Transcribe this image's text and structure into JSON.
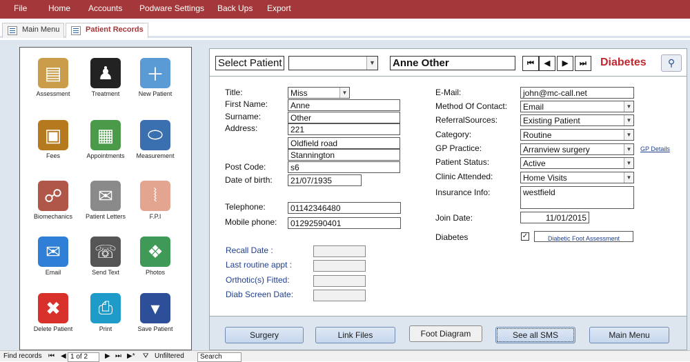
{
  "ribbon": {
    "menus": [
      "File",
      "Home",
      "Accounts",
      "Podware Settings",
      "Back Ups",
      "Export"
    ]
  },
  "tabs": [
    {
      "label": "Main Menu",
      "active": false
    },
    {
      "label": "Patient Records",
      "active": true
    }
  ],
  "tiles": [
    {
      "label": "Assessment",
      "icon": "assessment-icon",
      "color": "#c99d4a",
      "glyph": "▤"
    },
    {
      "label": "Treatment",
      "icon": "treatment-icon",
      "color": "#222222",
      "glyph": "♟"
    },
    {
      "label": "New Patient",
      "icon": "new-patient-icon",
      "color": "#5b9bd5",
      "glyph": "＋"
    },
    {
      "label": "Fees",
      "icon": "fees-icon",
      "color": "#b57a1e",
      "glyph": "▣"
    },
    {
      "label": "Appointments",
      "icon": "appointments-icon",
      "color": "#4a9a4a",
      "glyph": "▦"
    },
    {
      "label": "Measurement",
      "icon": "measurement-icon",
      "color": "#3a6fb0",
      "glyph": "⬭"
    },
    {
      "label": "Biomechanics",
      "icon": "biomechanics-icon",
      "color": "#b0574a",
      "glyph": "☍"
    },
    {
      "label": "Patient Letters",
      "icon": "patient-letters-icon",
      "color": "#8a8a8a",
      "glyph": "✉"
    },
    {
      "label": "F.P.I",
      "icon": "foot-icon",
      "color": "#e3a58f",
      "glyph": "⦚"
    },
    {
      "label": "Email",
      "icon": "email-icon",
      "color": "#2f7fd6",
      "glyph": "✉"
    },
    {
      "label": "Send Text",
      "icon": "send-text-icon",
      "color": "#555555",
      "glyph": "☏"
    },
    {
      "label": "Photos",
      "icon": "photos-icon",
      "color": "#3f9a58",
      "glyph": "❖"
    },
    {
      "label": "Delete Patient",
      "icon": "delete-patient-icon",
      "color": "#d8312b",
      "glyph": "✖"
    },
    {
      "label": "Print",
      "icon": "print-icon",
      "color": "#1e9bc8",
      "glyph": "⎙"
    },
    {
      "label": "Save Patient",
      "icon": "save-patient-icon",
      "color": "#2d4f9a",
      "glyph": "▾"
    }
  ],
  "topbar": {
    "select_patient_label": "Select Patient",
    "patient_combo_value": "",
    "patient_name": "Anne Other",
    "nav": [
      "⏮",
      "◀",
      "▶",
      "⏭"
    ],
    "condition": "Diabetes"
  },
  "left_fields": {
    "title": {
      "label": "Title:",
      "value": "Miss"
    },
    "first_name": {
      "label": "First Name:",
      "value": "Anne"
    },
    "surname": {
      "label": "Surname:",
      "value": "Other"
    },
    "address": {
      "label": "Address:",
      "lines": [
        "221",
        "Oldfield road",
        "Stannington"
      ]
    },
    "post_code": {
      "label": "Post Code:",
      "value": "s6"
    },
    "dob": {
      "label": "Date of birth:",
      "value": "21/07/1935"
    },
    "telephone": {
      "label": "Telephone:",
      "value": "01142346480"
    },
    "mobile": {
      "label": "Mobile phone:",
      "value": "01292590401"
    }
  },
  "recall_fields": {
    "recall_date": {
      "label": "Recall Date :",
      "value": ""
    },
    "last_routine": {
      "label": "Last routine appt :",
      "value": ""
    },
    "orthotics_fitted": {
      "label": "Orthotic(s)  Fitted:",
      "value": ""
    },
    "diab_screen": {
      "label": "Diab Screen Date:",
      "value": ""
    }
  },
  "right_fields": {
    "email": {
      "label": "E-Mail:",
      "value": "john@mc-call.net"
    },
    "contact_method": {
      "label": "Method Of Contact:",
      "value": "Email"
    },
    "referral": {
      "label": "ReferralSources:",
      "value": "Existing Patient"
    },
    "category": {
      "label": "Category:",
      "value": "Routine"
    },
    "gp_practice": {
      "label": "GP Practice:",
      "value": "Arranview surgery",
      "link": "GP Details"
    },
    "status": {
      "label": "Patient Status:",
      "value": "Active"
    },
    "clinic": {
      "label": "Clinic Attended:",
      "value": "Home Visits"
    },
    "insurance": {
      "label": "Insurance Info:",
      "value": "westfield"
    },
    "join_date": {
      "label": "Join Date:",
      "value": "11/01/2015"
    },
    "diabetes": {
      "label": "Diabetes",
      "checked": true,
      "check_glyph": "✓",
      "link": "Diabetic Foot Assessment"
    }
  },
  "buttons": {
    "surgery": "Surgery",
    "link_files": "Link Files",
    "foot_diagram": "Foot Diagram",
    "see_all_sms": "See all SMS",
    "main_menu": "Main Menu"
  },
  "statusbar": {
    "find_records": "Find records",
    "record_position": "1 of 2",
    "filter_state": "Unfiltered",
    "search_label": "Search"
  },
  "colors": {
    "ribbon": "#a4373a",
    "condition_text": "#c0282d",
    "form_background": "#dde5ef"
  }
}
